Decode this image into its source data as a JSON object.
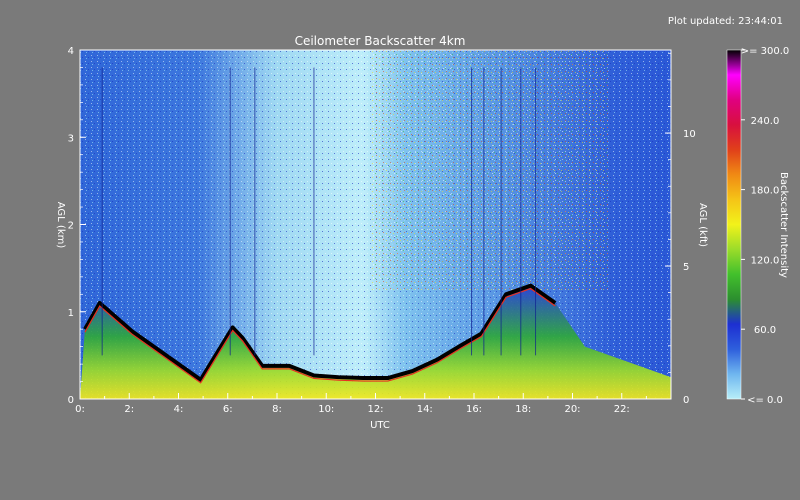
{
  "header": {
    "updated": "Plot updated: 23:44:01"
  },
  "chart_data": {
    "type": "heatmap",
    "title": "Ceilometer Backscatter 4km",
    "xlabel": "UTC",
    "ylabel_left": "AGL (km)",
    "ylabel_right": "AGL (kft)",
    "colorbar_label": "Backscatter Intensity",
    "x_range": [
      0,
      24
    ],
    "y_range_km": [
      0,
      4
    ],
    "x_ticks": [
      {
        "v": 0,
        "label": "0:"
      },
      {
        "v": 2,
        "label": "2:"
      },
      {
        "v": 4,
        "label": "4:"
      },
      {
        "v": 6,
        "label": "6:"
      },
      {
        "v": 8,
        "label": "8:"
      },
      {
        "v": 10,
        "label": "10:"
      },
      {
        "v": 12,
        "label": "12:"
      },
      {
        "v": 14,
        "label": "14:"
      },
      {
        "v": 16,
        "label": "16:"
      },
      {
        "v": 18,
        "label": "18:"
      },
      {
        "v": 20,
        "label": "20:"
      },
      {
        "v": 22,
        "label": "22:"
      }
    ],
    "y_ticks_left": [
      {
        "v": 0,
        "label": "0"
      },
      {
        "v": 1,
        "label": "1"
      },
      {
        "v": 2,
        "label": "2"
      },
      {
        "v": 3,
        "label": "3"
      },
      {
        "v": 4,
        "label": "4"
      }
    ],
    "y_ticks_right": [
      {
        "v": 0,
        "label": "0"
      },
      {
        "v": 5,
        "label": "5"
      },
      {
        "v": 10,
        "label": "10"
      }
    ],
    "colorbar_ticks": [
      {
        "v": 0,
        "label": "<=  0.0"
      },
      {
        "v": 60,
        "label": "60.0"
      },
      {
        "v": 120,
        "label": "120.0"
      },
      {
        "v": 180,
        "label": "180.0"
      },
      {
        "v": 240,
        "label": "240.0"
      },
      {
        "v": 300,
        "label": ">= 300.0"
      }
    ],
    "colorbar_range": [
      0,
      300
    ],
    "colorscale": [
      "#b7eef8",
      "#6fb6ef",
      "#2e5fdc",
      "#1d2fd2",
      "#2c8f2f",
      "#42c02c",
      "#9bdc2a",
      "#f2f21a",
      "#f5c417",
      "#f08a14",
      "#e0401a",
      "#d8103e",
      "#e00080",
      "#ff00ff",
      "#000000"
    ],
    "cloud_base": [
      {
        "t": 0.2,
        "h": 0.8
      },
      {
        "t": 0.8,
        "h": 1.1
      },
      {
        "t": 2.1,
        "h": 0.78
      },
      {
        "t": 4.9,
        "h": 0.22
      },
      {
        "t": 6.2,
        "h": 0.82
      },
      {
        "t": 6.6,
        "h": 0.7
      },
      {
        "t": 7.4,
        "h": 0.38
      },
      {
        "t": 8.5,
        "h": 0.38
      },
      {
        "t": 9.5,
        "h": 0.27
      },
      {
        "t": 10.5,
        "h": 0.25
      },
      {
        "t": 11.5,
        "h": 0.24
      },
      {
        "t": 12.5,
        "h": 0.24
      },
      {
        "t": 13.5,
        "h": 0.32
      },
      {
        "t": 14.5,
        "h": 0.45
      },
      {
        "t": 15.5,
        "h": 0.62
      },
      {
        "t": 16.3,
        "h": 0.75
      },
      {
        "t": 17.3,
        "h": 1.2
      },
      {
        "t": 18.3,
        "h": 1.3
      },
      {
        "t": 19.3,
        "h": 1.1
      }
    ]
  }
}
